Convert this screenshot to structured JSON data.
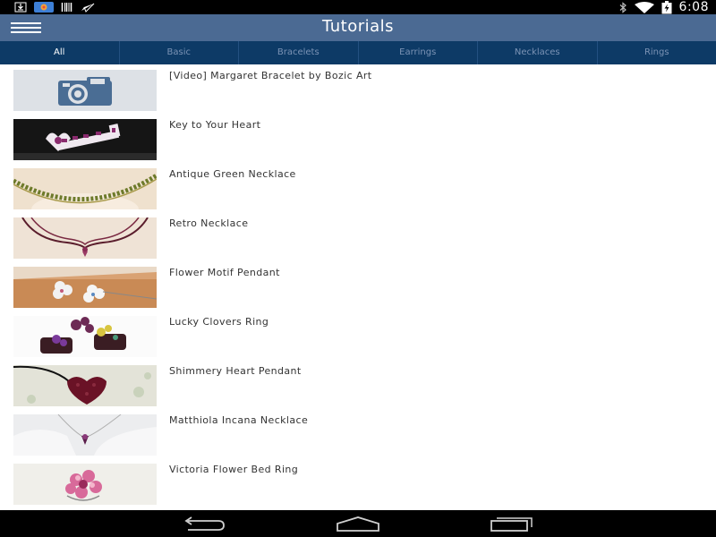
{
  "status_bar": {
    "time": "6:08",
    "icons": [
      "download-icon",
      "photos-icon",
      "barcode-icon",
      "send-icon",
      "bluetooth-icon",
      "wifi-icon",
      "battery-charging-icon"
    ]
  },
  "app_bar": {
    "title": "Tutorials",
    "menu_icon": "hamburger-menu-icon"
  },
  "tabs": [
    {
      "label": "All",
      "active": true
    },
    {
      "label": "Basic",
      "active": false
    },
    {
      "label": "Bracelets",
      "active": false
    },
    {
      "label": "Earrings",
      "active": false
    },
    {
      "label": "Necklaces",
      "active": false
    },
    {
      "label": "Rings",
      "active": false
    }
  ],
  "tutorials": [
    {
      "title": "[Video] Margaret Bracelet by Bozic Art",
      "thumbnail": "camera-placeholder-icon"
    },
    {
      "title": "Key to Your Heart",
      "thumbnail": "key-heart-photo"
    },
    {
      "title": "Antique Green Necklace",
      "thumbnail": "green-necklace-photo"
    },
    {
      "title": "Retro Necklace",
      "thumbnail": "retro-necklace-photo"
    },
    {
      "title": "Flower Motif Pendant",
      "thumbnail": "flower-pendant-photo"
    },
    {
      "title": "Lucky Clovers Ring",
      "thumbnail": "clover-rings-photo"
    },
    {
      "title": "Shimmery Heart Pendant",
      "thumbnail": "heart-pendant-photo"
    },
    {
      "title": "Matthiola Incana Necklace",
      "thumbnail": "matthiola-necklace-photo"
    },
    {
      "title": "Victoria Flower Bed Ring",
      "thumbnail": "flower-ring-photo"
    }
  ],
  "nav_bar": {
    "icons": [
      "back-icon",
      "home-icon",
      "recent-apps-icon"
    ]
  },
  "colors": {
    "app_bar": "#4b6a93",
    "tab_bar": "#0d3a66",
    "tab_active_text": "#ffffff",
    "tab_inactive_text": "#7b93b5"
  }
}
